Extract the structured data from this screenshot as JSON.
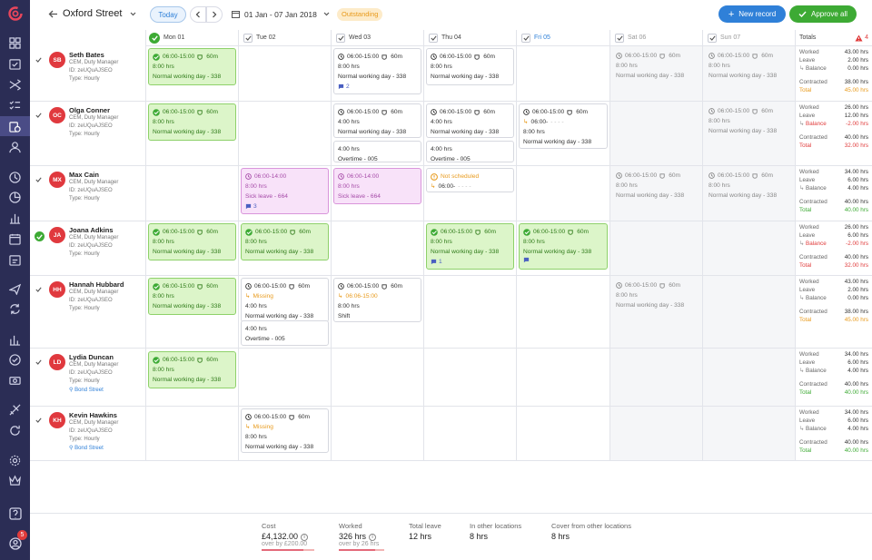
{
  "header": {
    "location": "Oxford Street",
    "today": "Today",
    "date_range": "01 Jan - 07 Jan 2018",
    "status_badge": "Outstanding",
    "new_record": "New record",
    "approve_all": "Approve all"
  },
  "days": [
    {
      "label": "Mon 01",
      "approved": true
    },
    {
      "label": "Tue 02",
      "approved": false
    },
    {
      "label": "Wed 03",
      "approved": false
    },
    {
      "label": "Thu 04",
      "approved": false
    },
    {
      "label": "Fri 05",
      "approved": false
    },
    {
      "label": "Sat 06",
      "approved": false
    },
    {
      "label": "Sun 07",
      "approved": false
    }
  ],
  "totals_header": {
    "label": "Totals",
    "warnings": "4"
  },
  "employees": [
    {
      "initials": "SB",
      "name": "Seth Bates",
      "role": "CEM, Duty Manager",
      "id": "ID: zeUQuAJSEO",
      "type": "Type: Hourly",
      "approved": false
    },
    {
      "initials": "OC",
      "name": "Olga Conner",
      "role": "CEM, Duty Manager",
      "id": "ID: zeUQuAJSEO",
      "type": "Type: Hourly",
      "approved": false
    },
    {
      "initials": "MX",
      "name": "Max Cain",
      "role": "CEM, Duty Manager",
      "id": "ID: zeUQuAJSEO",
      "type": "Type: Hourly",
      "approved": false
    },
    {
      "initials": "JA",
      "name": "Joana Adkins",
      "role": "CEM, Duty Manager",
      "id": "ID: zeUQuAJSEO",
      "type": "Type: Hourly",
      "approved": true
    },
    {
      "initials": "HH",
      "name": "Hannah Hubbard",
      "role": "CEM, Duty Manager",
      "id": "ID: zeUQuAJSEO",
      "type": "Type: Hourly",
      "approved": false
    },
    {
      "initials": "LD",
      "name": "Lydia Duncan",
      "role": "CEM, Duty Manager",
      "id": "ID: zeUQuAJSEO",
      "type": "Type: Hourly",
      "location": "Bond Street",
      "approved": false
    },
    {
      "initials": "KH",
      "name": "Kevin Hawkins",
      "role": "CEM, Duty Manager",
      "id": "ID: zeUQuAJSEO",
      "type": "Type: Hourly",
      "location": "Bond Street",
      "approved": false
    }
  ],
  "shift": {
    "time": "06:00-15:00",
    "time_short": "06:00-14:00",
    "break": "60m",
    "hours": "8:00 hrs",
    "hours_4": "4:00 hrs",
    "normal": "Normal working day - 338",
    "sick": "Sick leave - 664",
    "overtime": "Overtime - 005",
    "not_scheduled": "Not scheduled",
    "missing": "Missing",
    "clock_in": "06:00-",
    "clock_in_range": "06:06-15:00",
    "shift_label": "Shift",
    "comments_2": "2",
    "comments_3": "3",
    "comments_1": "1"
  },
  "totals": {
    "labels": {
      "worked": "Worked",
      "leave": "Leave",
      "balance": "Balance",
      "contracted": "Contracted",
      "total": "Total"
    },
    "rows": [
      {
        "worked": "43.00 hrs",
        "leave": "2.00 hrs",
        "balance": "0.00 hrs",
        "contracted": "38.00 hrs",
        "total": "45.00 hrs"
      },
      {
        "worked": "26.00 hrs",
        "leave": "12.00 hrs",
        "balance": "-2.00 hrs",
        "contracted": "40.00 hrs",
        "total": "32.00 hrs"
      },
      {
        "worked": "34.00 hrs",
        "leave": "6.00 hrs",
        "balance": "4.00 hrs",
        "contracted": "40.00 hrs",
        "total": "40.00 hrs"
      },
      {
        "worked": "26.00 hrs",
        "leave": "6.00 hrs",
        "balance": "-2.00 hrs",
        "contracted": "40.00 hrs",
        "total": "32.00 hrs"
      },
      {
        "worked": "43.00 hrs",
        "leave": "2.00 hrs",
        "balance": "0.00 hrs",
        "contracted": "38.00 hrs",
        "total": "45.00 hrs"
      },
      {
        "worked": "34.00 hrs",
        "leave": "6.00 hrs",
        "balance": "4.00 hrs",
        "contracted": "40.00 hrs",
        "total": "40.00 hrs"
      },
      {
        "worked": "34.00 hrs",
        "leave": "6.00 hrs",
        "balance": "4.00 hrs",
        "contracted": "40.00 hrs",
        "total": "40.00 hrs"
      }
    ]
  },
  "footer": {
    "cost": {
      "label": "Cost",
      "value": "£4,132.00",
      "sub": "over by £200.00"
    },
    "worked": {
      "label": "Worked",
      "value": "326 hrs",
      "sub": "over by 26 hrs"
    },
    "total_leave": {
      "label": "Total leave",
      "value": "12 hrs"
    },
    "other_locations": {
      "label": "In other locations",
      "value": "8 hrs"
    },
    "cover": {
      "label": "Cover from other locations",
      "value": "8 hrs"
    }
  },
  "colors": {
    "sidebar": "#2b2d55",
    "primary": "#2f80d8",
    "success": "#3daa34",
    "danger": "#e03b3b",
    "warning": "#e89a1b"
  },
  "sidebar_icons": [
    "grid-icon",
    "calendar-check-icon",
    "shuffle-icon",
    "checklist-icon",
    "timesheet-icon",
    "person-icon",
    "clock-icon",
    "pie-chart-icon",
    "bar-chart-icon",
    "calendar-icon",
    "calendar-note-icon",
    "plane-icon",
    "sync-icon",
    "bar-stats-icon",
    "check-circle-icon",
    "money-icon",
    "flight-icon",
    "refresh-icon",
    "gear-icon",
    "crown-icon",
    "help-icon",
    "profile-icon"
  ],
  "notifications": "5"
}
